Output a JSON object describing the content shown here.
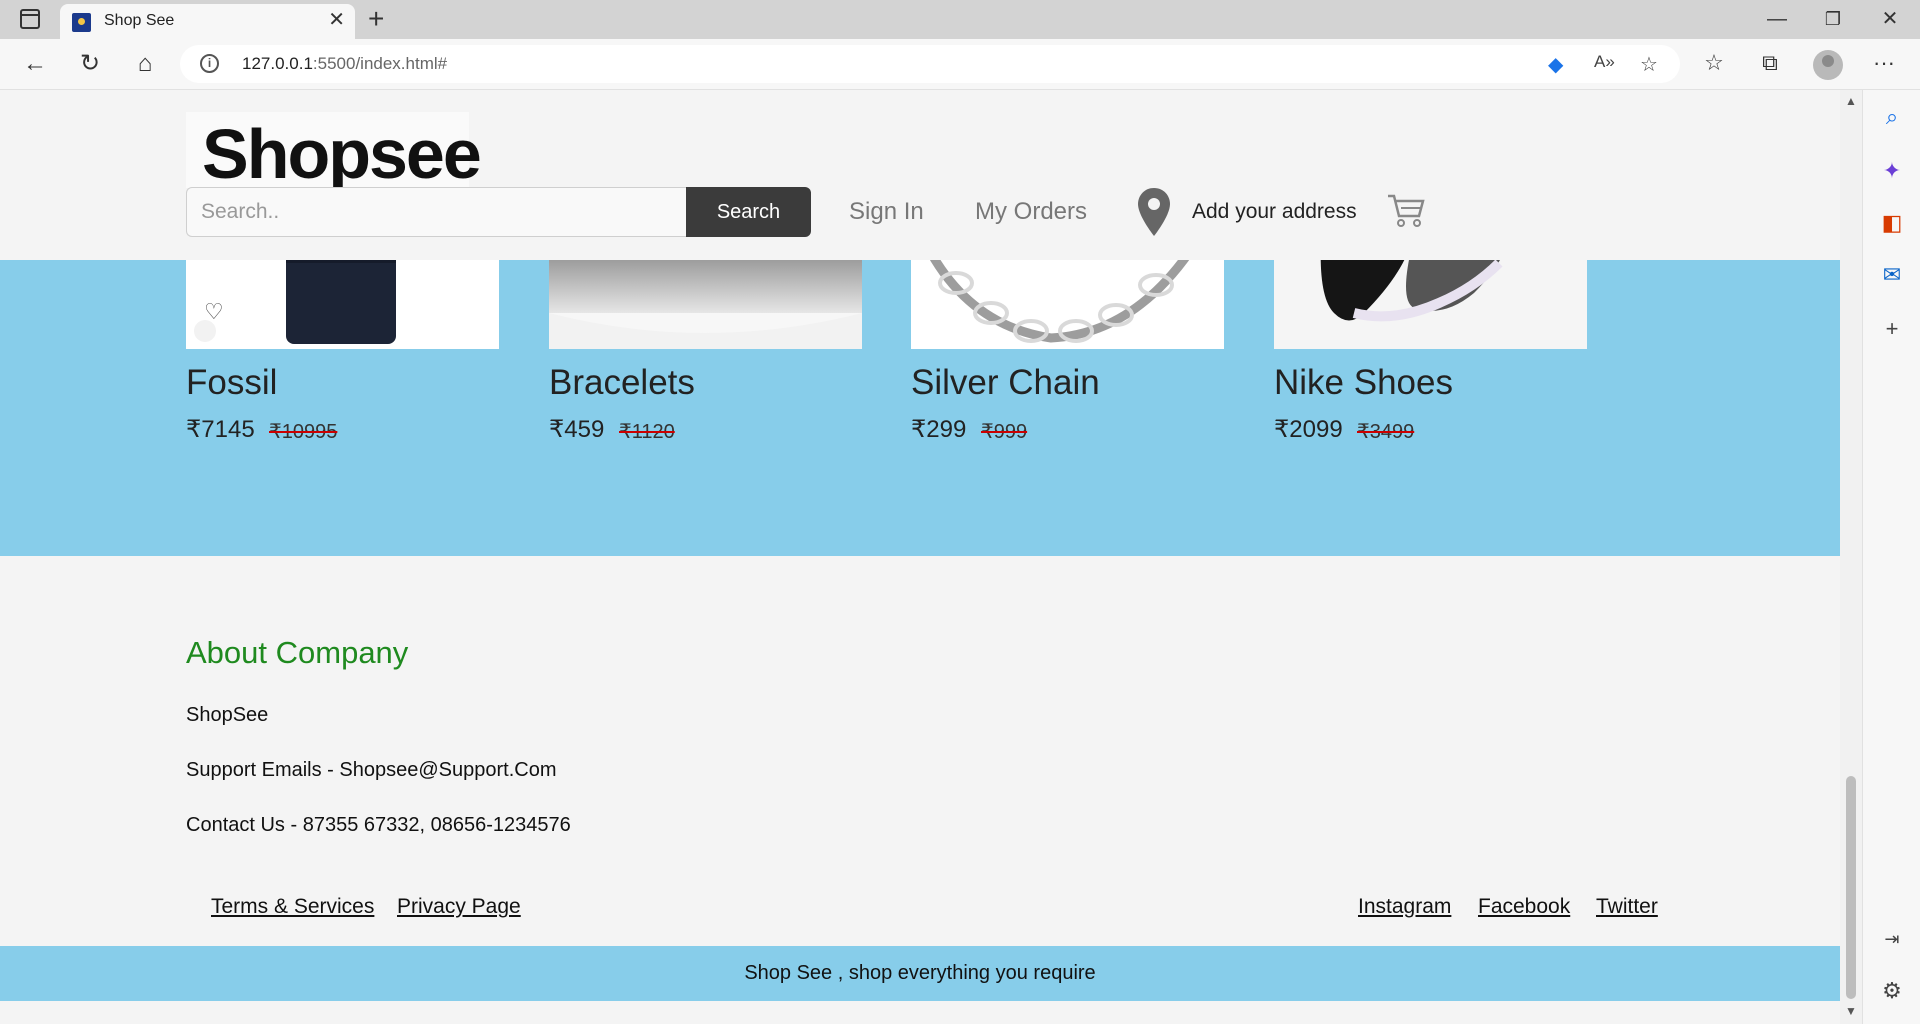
{
  "browser": {
    "tab_title": "Shop See",
    "url_host": "127.0.0.1",
    "url_rest": ":5500/index.html#"
  },
  "header": {
    "logo_text": "Shopsee",
    "search_placeholder": "Search..",
    "search_button": "Search",
    "sign_in": "Sign In",
    "my_orders": "My Orders",
    "address": "Add your address"
  },
  "products": [
    {
      "name": "Fossil",
      "price": "₹7145",
      "mrp": "₹10995"
    },
    {
      "name": "Bracelets",
      "price": "₹459",
      "mrp": "₹1120"
    },
    {
      "name": "Silver Chain",
      "price": "₹299",
      "mrp": "₹999"
    },
    {
      "name": "Nike Shoes",
      "price": "₹2099",
      "mrp": "₹3499"
    }
  ],
  "about": {
    "title": "About Company",
    "company": "ShopSee",
    "support": "Support Emails - Shopsee@Support.Com",
    "contact": "Contact Us - 87355 67332, 08656-1234576"
  },
  "footer": {
    "terms": "Terms & Services",
    "privacy": "Privacy Page",
    "instagram": "Instagram",
    "facebook": "Facebook",
    "twitter": "Twitter",
    "tagline": "Shop See , shop everything you require"
  },
  "colors": {
    "band": "#87cdea",
    "about_title": "#1f8a1f",
    "search_button": "#3b3b3b"
  },
  "icons": {
    "wishlist": "heart-icon",
    "location": "map-pin-icon",
    "cart": "cart-icon"
  }
}
